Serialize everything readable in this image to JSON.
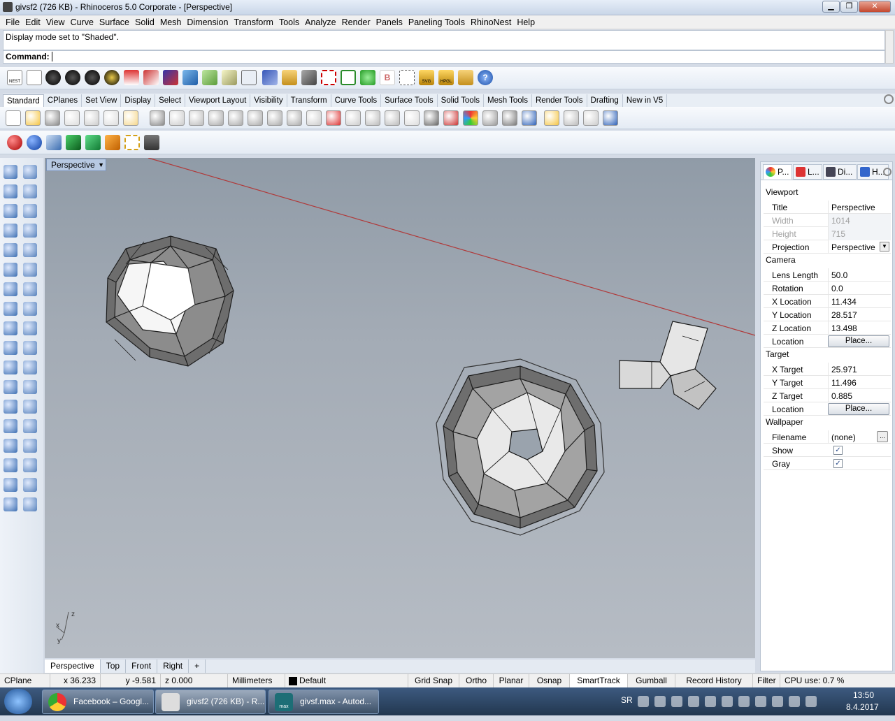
{
  "window": {
    "title": "givsf2 (726 KB) - Rhinoceros  5.0 Corporate - [Perspective]"
  },
  "menu": [
    "File",
    "Edit",
    "View",
    "Curve",
    "Surface",
    "Solid",
    "Mesh",
    "Dimension",
    "Transform",
    "Tools",
    "Analyze",
    "Render",
    "Panels",
    "Paneling Tools",
    "RhinoNest",
    "Help"
  ],
  "command": {
    "history": "Display mode set to \"Shaded\".",
    "prompt": "Command:"
  },
  "toolbar_tabs": [
    "Standard",
    "CPlanes",
    "Set View",
    "Display",
    "Select",
    "Viewport Layout",
    "Visibility",
    "Transform",
    "Curve Tools",
    "Surface Tools",
    "Solid Tools",
    "Mesh Tools",
    "Render Tools",
    "Drafting",
    "New in V5"
  ],
  "toolbar_icon_labels": {
    "nest": "NEST",
    "svg": "SVG",
    "hpgl": "HPGL"
  },
  "viewport": {
    "name": "Perspective",
    "axis_x": "x",
    "axis_y": "y",
    "axis_z": "z"
  },
  "viewport_tabs": [
    "Perspective",
    "Top",
    "Front",
    "Right",
    "+"
  ],
  "panel": {
    "tabs": [
      "P...",
      "L...",
      "Di...",
      "H..."
    ],
    "viewport_section": "Viewport",
    "camera_section": "Camera",
    "target_section": "Target",
    "wallpaper_section": "Wallpaper",
    "viewport": [
      {
        "k": "Title",
        "v": "Perspective"
      },
      {
        "k": "Width",
        "v": "1014"
      },
      {
        "k": "Height",
        "v": "715"
      },
      {
        "k": "Projection",
        "v": "Perspective"
      }
    ],
    "camera": [
      {
        "k": "Lens Length",
        "v": "50.0"
      },
      {
        "k": "Rotation",
        "v": "0.0"
      },
      {
        "k": "X Location",
        "v": "11.434"
      },
      {
        "k": "Y Location",
        "v": "28.517"
      },
      {
        "k": "Z Location",
        "v": "13.498"
      },
      {
        "k": "Location",
        "v": "Place..."
      }
    ],
    "target": [
      {
        "k": "X Target",
        "v": "25.971"
      },
      {
        "k": "Y Target",
        "v": "11.496"
      },
      {
        "k": "Z Target",
        "v": "0.885"
      },
      {
        "k": "Location",
        "v": "Place..."
      }
    ],
    "wallpaper": [
      {
        "k": "Filename",
        "v": "(none)"
      },
      {
        "k": "Show",
        "v": "✓"
      },
      {
        "k": "Gray",
        "v": "✓"
      }
    ],
    "browse": "..."
  },
  "status": {
    "cplane": "CPlane",
    "x": "x 36.233",
    "y": "y -9.581",
    "z": "z 0.000",
    "units": "Millimeters",
    "layer": "Default",
    "items": [
      "Grid Snap",
      "Ortho",
      "Planar",
      "Osnap",
      "SmartTrack",
      "Gumball",
      "Record History",
      "Filter"
    ],
    "cpu": "CPU use: 0.7 %"
  },
  "taskbar": {
    "apps": [
      "Facebook – Googl...",
      "givsf2 (726 KB) - R...",
      "givsf.max - Autod..."
    ],
    "lang": "SR",
    "time": "13:50",
    "date": "8.4.2017",
    "max_label": "max"
  },
  "colors": {
    "viewport_top": "#909ba7",
    "viewport_bottom": "#b6bcc4",
    "x_axis": "#b03a3a",
    "accent": "#3d5a80"
  }
}
